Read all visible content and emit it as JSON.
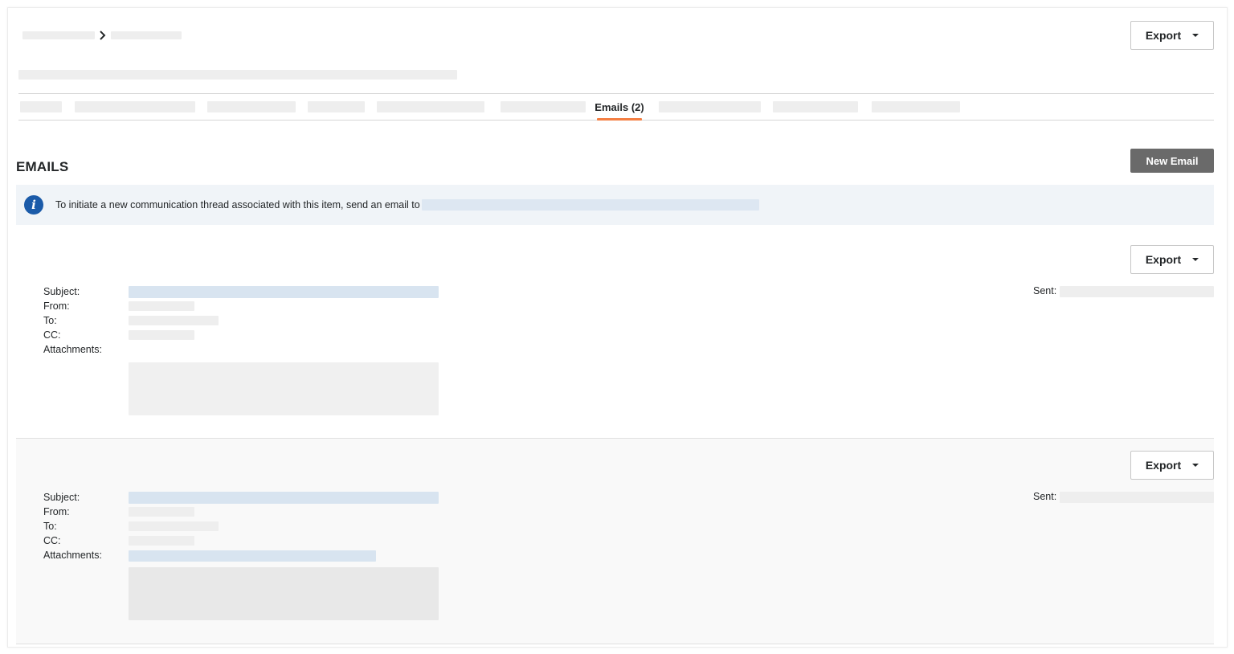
{
  "header": {
    "export_label": "Export"
  },
  "tabs": {
    "active_label": "Emails (2)"
  },
  "section": {
    "title": "EMAILS",
    "new_email_label": "New Email"
  },
  "info_banner": {
    "text": "To initiate a new communication thread associated with this item, send an email to"
  },
  "emails": [
    {
      "export_label": "Export",
      "subject_label": "Subject:",
      "from_label": "From:",
      "to_label": "To:",
      "cc_label": "CC:",
      "attachments_label": "Attachments:",
      "sent_label": "Sent:"
    },
    {
      "export_label": "Export",
      "subject_label": "Subject:",
      "from_label": "From:",
      "to_label": "To:",
      "cc_label": "CC:",
      "attachments_label": "Attachments:",
      "sent_label": "Sent:"
    }
  ],
  "colors": {
    "accent_tab_underline": "#f47e42",
    "info_icon": "#1b5ba9",
    "new_email_button": "#6a6a6a",
    "info_banner_bg": "#f0f4f8"
  },
  "icons": {
    "breadcrumb_separator": "chevron-right-icon",
    "info": "info-icon",
    "dropdown": "caret-down-icon"
  }
}
